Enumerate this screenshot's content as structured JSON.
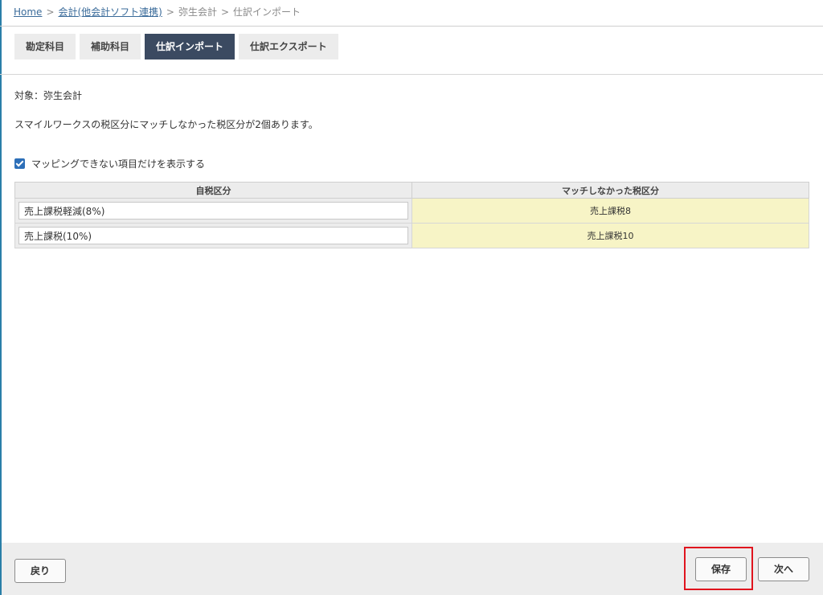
{
  "breadcrumb": {
    "home": "Home",
    "accounting": "会計(他会計ソフト連携)",
    "yayoi": "弥生会計",
    "current": "仕訳インポート",
    "separator": ">"
  },
  "tabs": [
    {
      "label": "勘定科目",
      "active": false
    },
    {
      "label": "補助科目",
      "active": false
    },
    {
      "label": "仕訳インポート",
      "active": true
    },
    {
      "label": "仕訳エクスポート",
      "active": false
    }
  ],
  "target_text": "対象：弥生会計",
  "notice_text": "スマイルワークスの税区分にマッチしなかった税区分が2個あります。",
  "filter": {
    "checked": true,
    "label": "マッピングできない項目だけを表示する"
  },
  "table": {
    "headers": [
      "自税区分",
      "マッチしなかった税区分"
    ],
    "rows": [
      {
        "own_tax": "売上課税軽減(8%)",
        "unmatched": "売上課税8"
      },
      {
        "own_tax": "売上課税(10%)",
        "unmatched": "売上課税10"
      }
    ]
  },
  "footer": {
    "back_label": "戻り",
    "save_label": "保存",
    "next_label": "次へ"
  },
  "colors": {
    "active_tab": "#3b4a61",
    "highlight_border": "#e0141e",
    "unmatched_cell": "#f7f4c6",
    "checkbox": "#2d6fb8"
  }
}
